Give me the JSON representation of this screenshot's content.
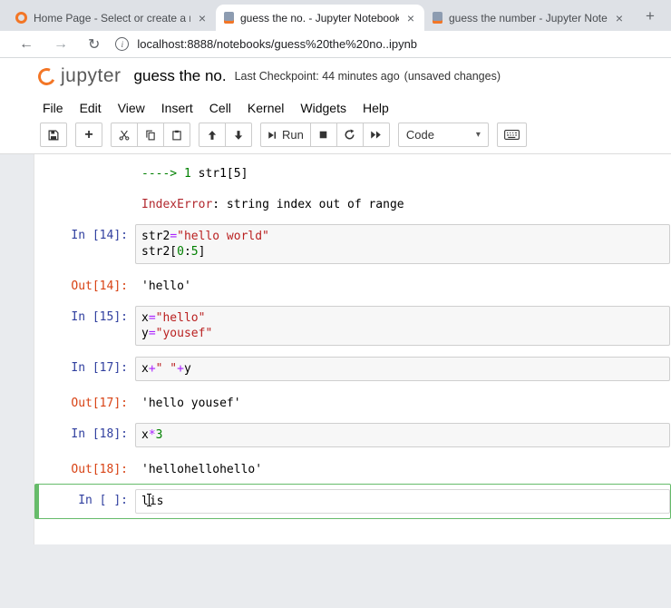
{
  "colors": {
    "jupyter-orange": "#f37626",
    "in-prompt": "#303f9f",
    "out-prompt": "#d84315",
    "code-string": "#ba2121",
    "code-operator": "#aa22ff",
    "code-number": "#008000",
    "tb-arrow": "#008000",
    "tb-error": "#b2282e",
    "active-cell": "#66bb6a"
  },
  "browser": {
    "tabs": [
      {
        "title": "Home Page - Select or create a n",
        "icon": "jupyter-home",
        "active": false
      },
      {
        "title": "guess the no. - Jupyter Notebook",
        "icon": "jupyter-notebook",
        "active": true
      },
      {
        "title": "guess the number - Jupyter Note",
        "icon": "jupyter-notebook",
        "active": false
      }
    ],
    "new_tab_label": "+",
    "nav": {
      "back": "←",
      "forward": "→",
      "reload": "↻"
    },
    "url": "localhost:8888/notebooks/guess%20the%20no..ipynb"
  },
  "icons": {
    "tab_close": "×",
    "dropdown_caret": "▾",
    "info": "i"
  },
  "header": {
    "logo_text": "jupyter",
    "title": "guess the no.",
    "checkpoint": "Last Checkpoint: 44 minutes ago",
    "unsaved": "(unsaved changes)"
  },
  "menubar": {
    "items": [
      "File",
      "Edit",
      "View",
      "Insert",
      "Cell",
      "Kernel",
      "Widgets",
      "Help"
    ]
  },
  "toolbar": {
    "run_label": "Run",
    "cell_type": "Code",
    "buttons": [
      "save",
      "insert-cell-below",
      "cut-cells",
      "copy-cells",
      "paste-cells",
      "move-cells-up",
      "move-cells-down",
      "run",
      "interrupt-kernel",
      "restart-kernel",
      "restart-run-all",
      "cell-type-select",
      "command-palette"
    ]
  },
  "notebook": {
    "cells": [
      {
        "kind": "output",
        "prompt": "",
        "lines": [
          [
            {
              "t": "----> 1 ",
              "c": "arrow"
            },
            {
              "t": "str1[5]",
              "c": "plain"
            }
          ],
          [],
          [
            {
              "t": "IndexError",
              "c": "err"
            },
            {
              "t": ": string index out of range",
              "c": "plain"
            }
          ]
        ]
      },
      {
        "kind": "code",
        "prompt": "In [14]:",
        "lines": [
          [
            {
              "t": "str2",
              "c": "plain"
            },
            {
              "t": "=",
              "c": "op"
            },
            {
              "t": "\"hello world\"",
              "c": "str"
            }
          ],
          [
            {
              "t": "str2[",
              "c": "plain"
            },
            {
              "t": "0",
              "c": "num"
            },
            {
              "t": ":",
              "c": "plain"
            },
            {
              "t": "5",
              "c": "num"
            },
            {
              "t": "]",
              "c": "plain"
            }
          ]
        ]
      },
      {
        "kind": "output",
        "prompt": "Out[14]:",
        "lines": [
          [
            {
              "t": "'hello'",
              "c": "plain"
            }
          ]
        ]
      },
      {
        "kind": "code",
        "prompt": "In [15]:",
        "lines": [
          [
            {
              "t": "x",
              "c": "plain"
            },
            {
              "t": "=",
              "c": "op"
            },
            {
              "t": "\"hello\"",
              "c": "str"
            }
          ],
          [
            {
              "t": "y",
              "c": "plain"
            },
            {
              "t": "=",
              "c": "op"
            },
            {
              "t": "\"yousef\"",
              "c": "str"
            }
          ]
        ]
      },
      {
        "kind": "code",
        "prompt": "In [17]:",
        "lines": [
          [
            {
              "t": "x",
              "c": "plain"
            },
            {
              "t": "+",
              "c": "op"
            },
            {
              "t": "\" \"",
              "c": "str"
            },
            {
              "t": "+",
              "c": "op"
            },
            {
              "t": "y",
              "c": "plain"
            }
          ]
        ]
      },
      {
        "kind": "output",
        "prompt": "Out[17]:",
        "lines": [
          [
            {
              "t": "'hello yousef'",
              "c": "plain"
            }
          ]
        ]
      },
      {
        "kind": "code",
        "prompt": "In [18]:",
        "lines": [
          [
            {
              "t": "x",
              "c": "plain"
            },
            {
              "t": "*",
              "c": "op"
            },
            {
              "t": "3",
              "c": "num"
            }
          ]
        ]
      },
      {
        "kind": "output",
        "prompt": "Out[18]:",
        "lines": [
          [
            {
              "t": "'hellohellohello'",
              "c": "plain"
            }
          ]
        ]
      },
      {
        "kind": "code",
        "prompt": "In [ ]:",
        "active": true,
        "lines": [
          [
            {
              "t": "l",
              "c": "plain"
            },
            {
              "caret": true
            },
            {
              "t": "is",
              "c": "plain"
            }
          ]
        ]
      }
    ]
  }
}
